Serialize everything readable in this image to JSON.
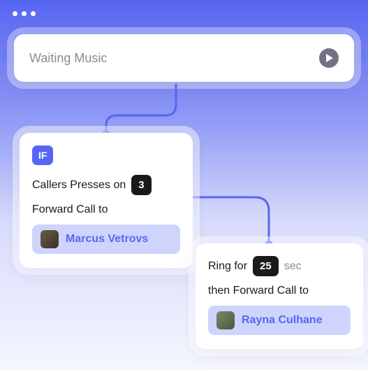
{
  "header": {
    "waiting_label": "Waiting Music"
  },
  "node1": {
    "if_label": "IF",
    "line1_prefix": "Callers Presses on",
    "key_value": "3",
    "line2": "Forward Call to",
    "person": "Marcus Vetrovs"
  },
  "node2": {
    "ring_prefix": "Ring for",
    "ring_value": "25",
    "ring_suffix": "sec",
    "line2": "then Forward Call to",
    "person": "Rayna Culhane"
  }
}
